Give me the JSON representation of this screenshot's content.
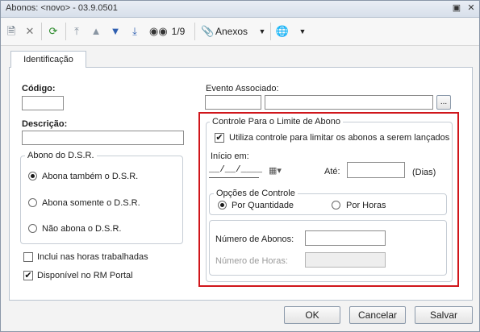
{
  "window": {
    "title": "Abonos: <novo> - 03.9.0501"
  },
  "toolbar": {
    "record_pos": "1/9",
    "anexos_label": "Anexos"
  },
  "tabs": [
    {
      "label": "Identificação"
    }
  ],
  "form": {
    "codigo_label": "Código:",
    "descricao_label": "Descrição:",
    "evento_label": "Evento Associado:",
    "evento_btn": "...",
    "dsr_group": "Abono do D.S.R.",
    "dsr_options": [
      "Abona também o D.S.R.",
      "Abona somente o D.S.R.",
      "Não abona o D.S.R."
    ],
    "dsr_selected": 0,
    "inclui_label": "Inclui nas horas trabalhadas",
    "inclui_checked": false,
    "portal_label": "Disponível no RM Portal",
    "portal_checked": true
  },
  "controle": {
    "group_label": "Controle Para o Limite de Abono",
    "utiliza_label": "Utiliza controle para limitar os abonos a serem lançados",
    "utiliza_checked": true,
    "inicio_label": "Início em:",
    "inicio_value": "__/__/____",
    "ate_label": "Até:",
    "dias_label": "(Dias)",
    "opcoes_label": "Opções de Controle",
    "por_quantidade": "Por Quantidade",
    "por_horas": "Por Horas",
    "selected_option": "Por Quantidade",
    "num_abonos_label": "Número de Abonos:",
    "num_horas_label": "Número de Horas:"
  },
  "buttons": {
    "ok": "OK",
    "cancel": "Cancelar",
    "save": "Salvar"
  },
  "colors": {
    "highlight_border": "#d0161b"
  }
}
